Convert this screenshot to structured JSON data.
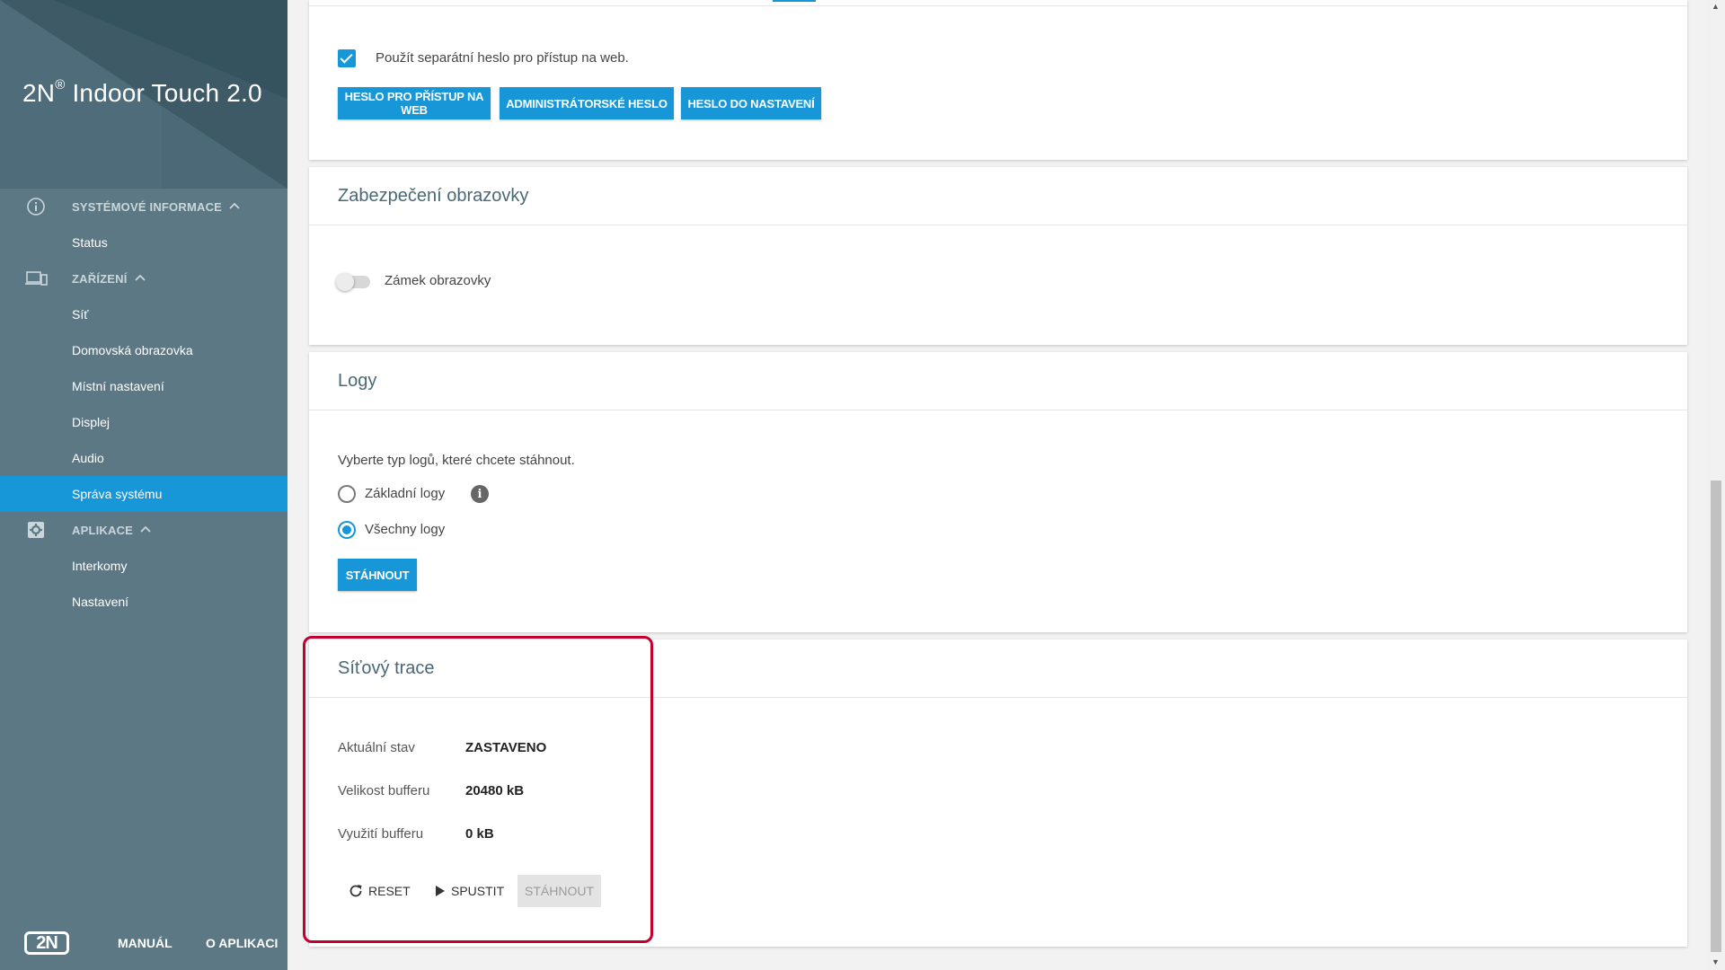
{
  "app": {
    "title_brand": "2N",
    "title_reg": "®",
    "title_rest": " Indoor Touch 2.0"
  },
  "sidebar": {
    "groups": [
      {
        "label": "Systémové informace",
        "icon": "info-circle-icon",
        "items": [
          "Status"
        ]
      },
      {
        "label": "Zařízení",
        "icon": "devices-icon",
        "items": [
          "Síť",
          "Domovská obrazovka",
          "Místní nastavení",
          "Displej",
          "Audio",
          "Správa systému"
        ]
      },
      {
        "label": "Aplikace",
        "icon": "gear-box-icon",
        "items": [
          "Interkomy",
          "Nastavení"
        ]
      }
    ],
    "active_item": "Správa systému",
    "footer": {
      "logo": "2N",
      "manual": "Manuál",
      "about": "O aplikaci"
    }
  },
  "passwords_card": {
    "checkbox_label": "Použít separátní heslo pro přístup na web.",
    "checkbox_checked": true,
    "buttons": [
      "Heslo pro přístup na web",
      "Administrátorské heslo",
      "Heslo do nastavení"
    ]
  },
  "screen_security": {
    "title": "Zabezpečení obrazovky",
    "toggle_label": "Zámek obrazovky",
    "toggle_on": false
  },
  "logs": {
    "title": "Logy",
    "prompt": "Vyberte typ logů, které chcete stáhnout.",
    "options": [
      "Základní logy",
      "Všechny logy"
    ],
    "selected": "Všechny logy",
    "download_label": "Stáhnout"
  },
  "network_trace": {
    "title": "Síťový trace",
    "rows": [
      {
        "label": "Aktuální stav",
        "value": "ZASTAVENO"
      },
      {
        "label": "Velikost bufferu",
        "value": "20480 kB"
      },
      {
        "label": "Využití bufferu",
        "value": "0 kB"
      }
    ],
    "actions": {
      "reset": "Reset",
      "start": "Spustit",
      "download": "Stáhnout"
    }
  },
  "colors": {
    "accent": "#1796d8",
    "sidebar": "#5c7885",
    "highlight": "#c2002f"
  }
}
